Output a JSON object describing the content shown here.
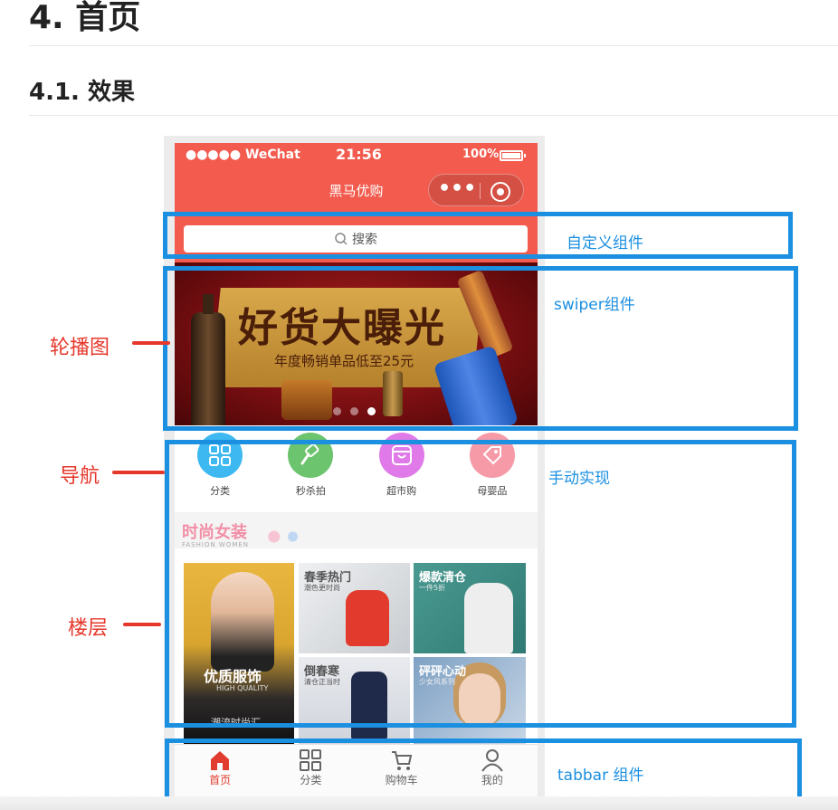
{
  "doc": {
    "h1": "4. 首页",
    "h2": "4.1. 效果"
  },
  "phone": {
    "status": {
      "carrier": "●●●●● WeChat",
      "time": "21:56",
      "battery": "100%"
    },
    "nav_title": "黑马优购",
    "capsule_menu": "•••",
    "search_placeholder": "搜索",
    "banner": {
      "headline": "好货大曝光",
      "subline": "年度畅销单品低至25元",
      "dots": 3,
      "active_dot": 3
    },
    "nav_items": [
      {
        "label": "分类",
        "color": "#3db8f0",
        "icon": "grid-icon"
      },
      {
        "label": "秒杀拍",
        "color": "#6cc46e",
        "icon": "hammer-icon"
      },
      {
        "label": "超市购",
        "color": "#df7ae8",
        "icon": "shopping-bag-icon"
      },
      {
        "label": "母婴品",
        "color": "#f59aa6",
        "icon": "tag-icon"
      }
    ],
    "floor": {
      "title": "时尚女装",
      "subtitle": "FASHION WOMEN",
      "tiles": {
        "big": {
          "title": "优质服饰",
          "sub": "HIGH QUALITY",
          "line": "潮流时尚汇"
        },
        "a": {
          "title": "春季热门",
          "sub": "潮色更时尚"
        },
        "b": {
          "title": "爆款清仓",
          "sub": "一件5折"
        },
        "c": {
          "title": "倒春寒",
          "sub": "清仓正当时"
        },
        "d": {
          "title": "砰砰心动",
          "sub": "少女风系列"
        }
      }
    },
    "tabbar": [
      {
        "label": "首页",
        "icon": "home-icon",
        "active": true
      },
      {
        "label": "分类",
        "icon": "grid-icon",
        "active": false
      },
      {
        "label": "购物车",
        "icon": "cart-icon",
        "active": false
      },
      {
        "label": "我的",
        "icon": "user-icon",
        "active": false
      }
    ]
  },
  "annotations": {
    "search": "自定义组件",
    "swiper": "swiper组件",
    "nav": "手动实现",
    "tabbar": "tabbar 组件"
  },
  "side_labels": {
    "swiper": "轮播图",
    "nav": "导航",
    "floor": "楼层"
  },
  "colors": {
    "brand_red": "#f25b4e",
    "highlight_blue": "#1b8fe0",
    "label_red": "#e6372b"
  }
}
